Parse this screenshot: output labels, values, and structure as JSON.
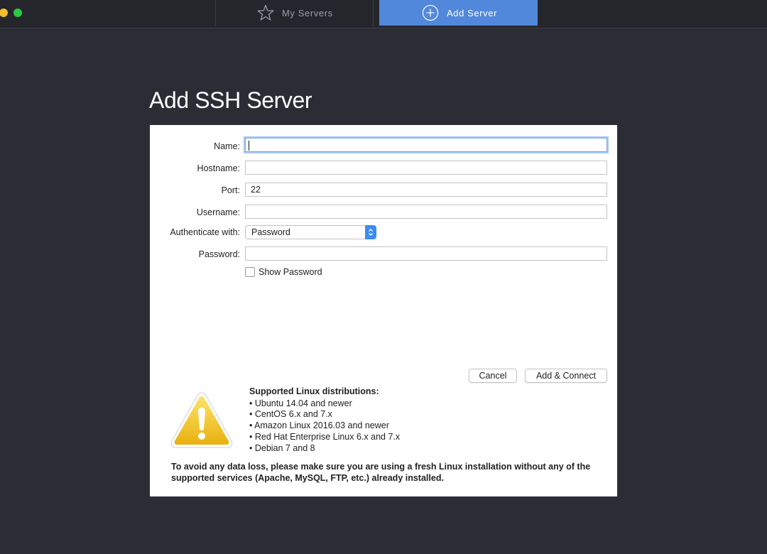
{
  "window": {
    "tabs": [
      {
        "label": "My Servers",
        "icon": "star-icon",
        "active": false
      },
      {
        "label": "Add Server",
        "icon": "plus-circle-icon",
        "active": true
      }
    ],
    "accent": "#5288db"
  },
  "page": {
    "title": "Add SSH Server"
  },
  "form": {
    "name_label": "Name:",
    "name_value": "",
    "hostname_label": "Hostname:",
    "hostname_value": "",
    "port_label": "Port:",
    "port_value": "22",
    "username_label": "Username:",
    "username_value": "",
    "auth_label": "Authenticate with:",
    "auth_value": "Password",
    "password_label": "Password:",
    "password_value": "",
    "show_password_label": "Show Password",
    "show_password_checked": false
  },
  "buttons": {
    "cancel": "Cancel",
    "connect": "Add & Connect"
  },
  "info": {
    "icon": "warning-triangle-icon",
    "title": "Supported Linux distributions:",
    "items": [
      "• Ubuntu 14.04 and newer",
      "• CentOS 6.x and 7.x",
      "• Amazon Linux 2016.03 and newer",
      "• Red Hat Enterprise Linux 6.x and 7.x",
      "• Debian 7 and 8"
    ],
    "notice": "To avoid any data loss, please make sure you are using a fresh Linux installation without any of the supported services (Apache, MySQL, FTP, etc.) already installed."
  }
}
